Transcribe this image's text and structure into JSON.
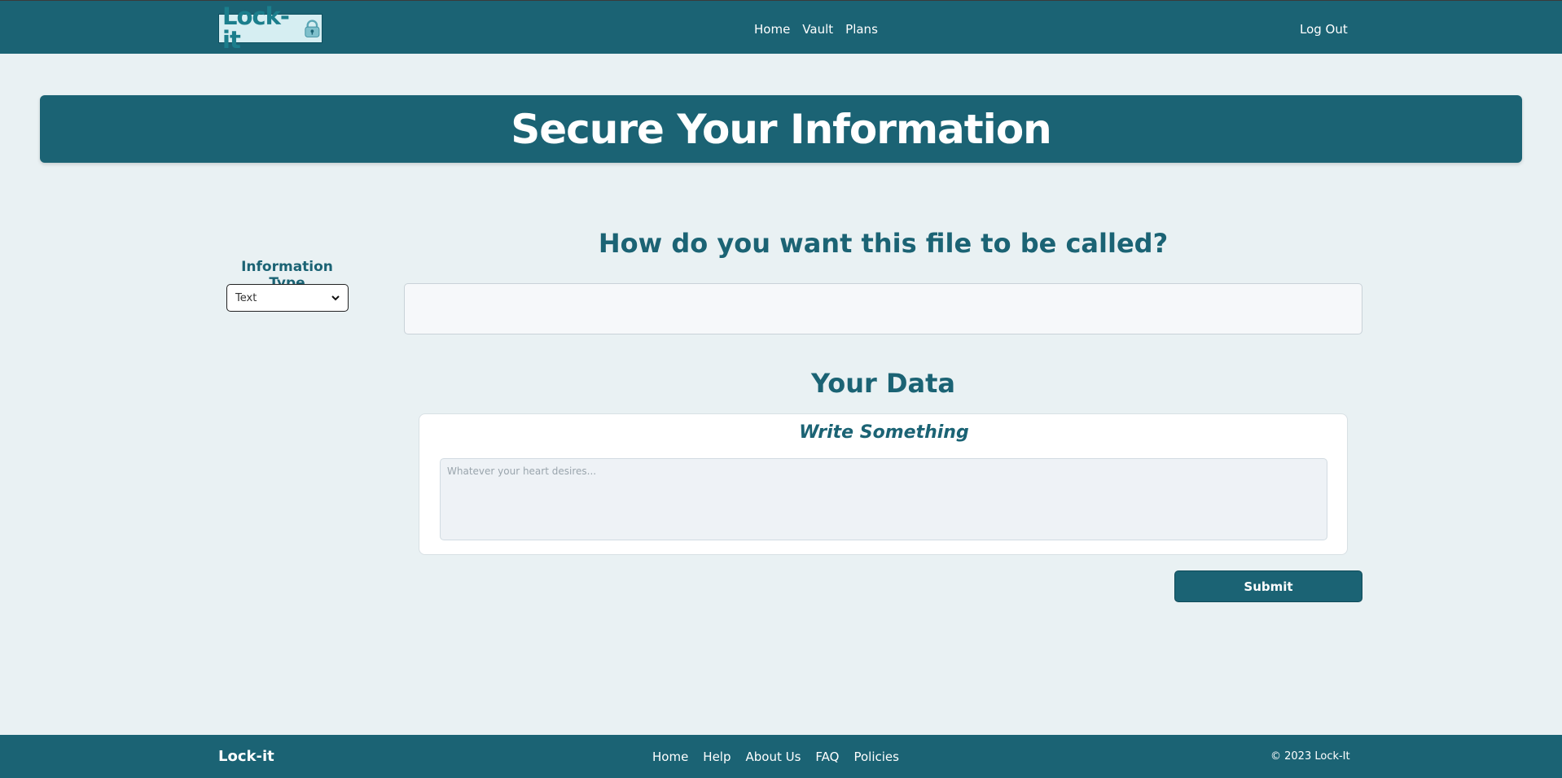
{
  "header": {
    "logo_text": "Lock-it",
    "nav": [
      {
        "label": "Home"
      },
      {
        "label": "Vault"
      },
      {
        "label": "Plans"
      }
    ],
    "logout_label": "Log Out"
  },
  "hero": {
    "title": "Secure Your Information"
  },
  "info_type": {
    "label": "Information Type",
    "selected": "Text",
    "icon": "chevron-down-icon"
  },
  "file_name": {
    "heading": "How do you want this file to be called?",
    "value": "",
    "placeholder": ""
  },
  "data": {
    "heading": "Your Data",
    "card_title": "Write Something",
    "placeholder": "Whatever your heart desires...",
    "value": ""
  },
  "actions": {
    "submit_label": "Submit"
  },
  "footer": {
    "brand": "Lock-it",
    "links": [
      {
        "label": "Home"
      },
      {
        "label": "Help"
      },
      {
        "label": "About Us"
      },
      {
        "label": "FAQ"
      },
      {
        "label": "Policies"
      }
    ],
    "copyright": "© 2023 Lock-It"
  },
  "colors": {
    "primary": "#1b6374",
    "background": "#e9f1f3",
    "accent": "#1b7e8c"
  }
}
